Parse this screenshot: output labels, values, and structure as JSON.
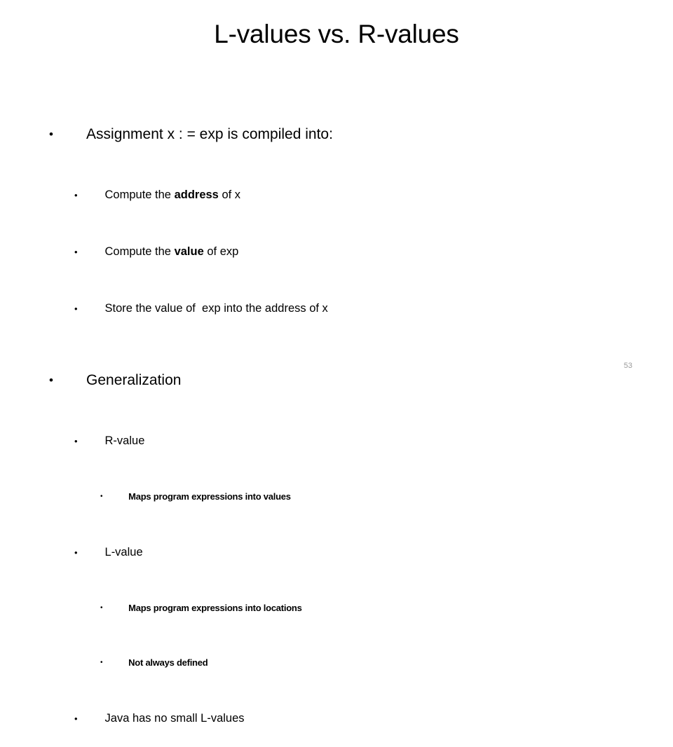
{
  "slide": {
    "title": "L-values vs. R-values",
    "page_number": "53",
    "bullet_glyph_level1": "•",
    "bullet_glyph_level2": "•",
    "bullet_glyph_level3": "•",
    "background_color": "#ffffff",
    "text_color": "#000000",
    "page_number_color": "#9a9a9a"
  },
  "content": {
    "assignment": {
      "heading": "Assignment x : = exp is compiled into:",
      "steps": [
        {
          "pre": "Compute the ",
          "emphasis": "address",
          "post": " of x"
        },
        {
          "pre": "Compute the ",
          "emphasis": "value",
          "post": " of exp"
        },
        {
          "pre": "Store the value of  exp into the address of x",
          "emphasis": "",
          "post": ""
        }
      ]
    },
    "generalization": {
      "heading": "Generalization",
      "items": [
        {
          "label": "R-value",
          "details": [
            "Maps program expressions into values"
          ]
        },
        {
          "label": "L-value",
          "details": [
            "Maps program expressions into locations",
            "Not always defined"
          ]
        },
        {
          "label": "Java has no small L-values",
          "details": []
        }
      ]
    }
  }
}
